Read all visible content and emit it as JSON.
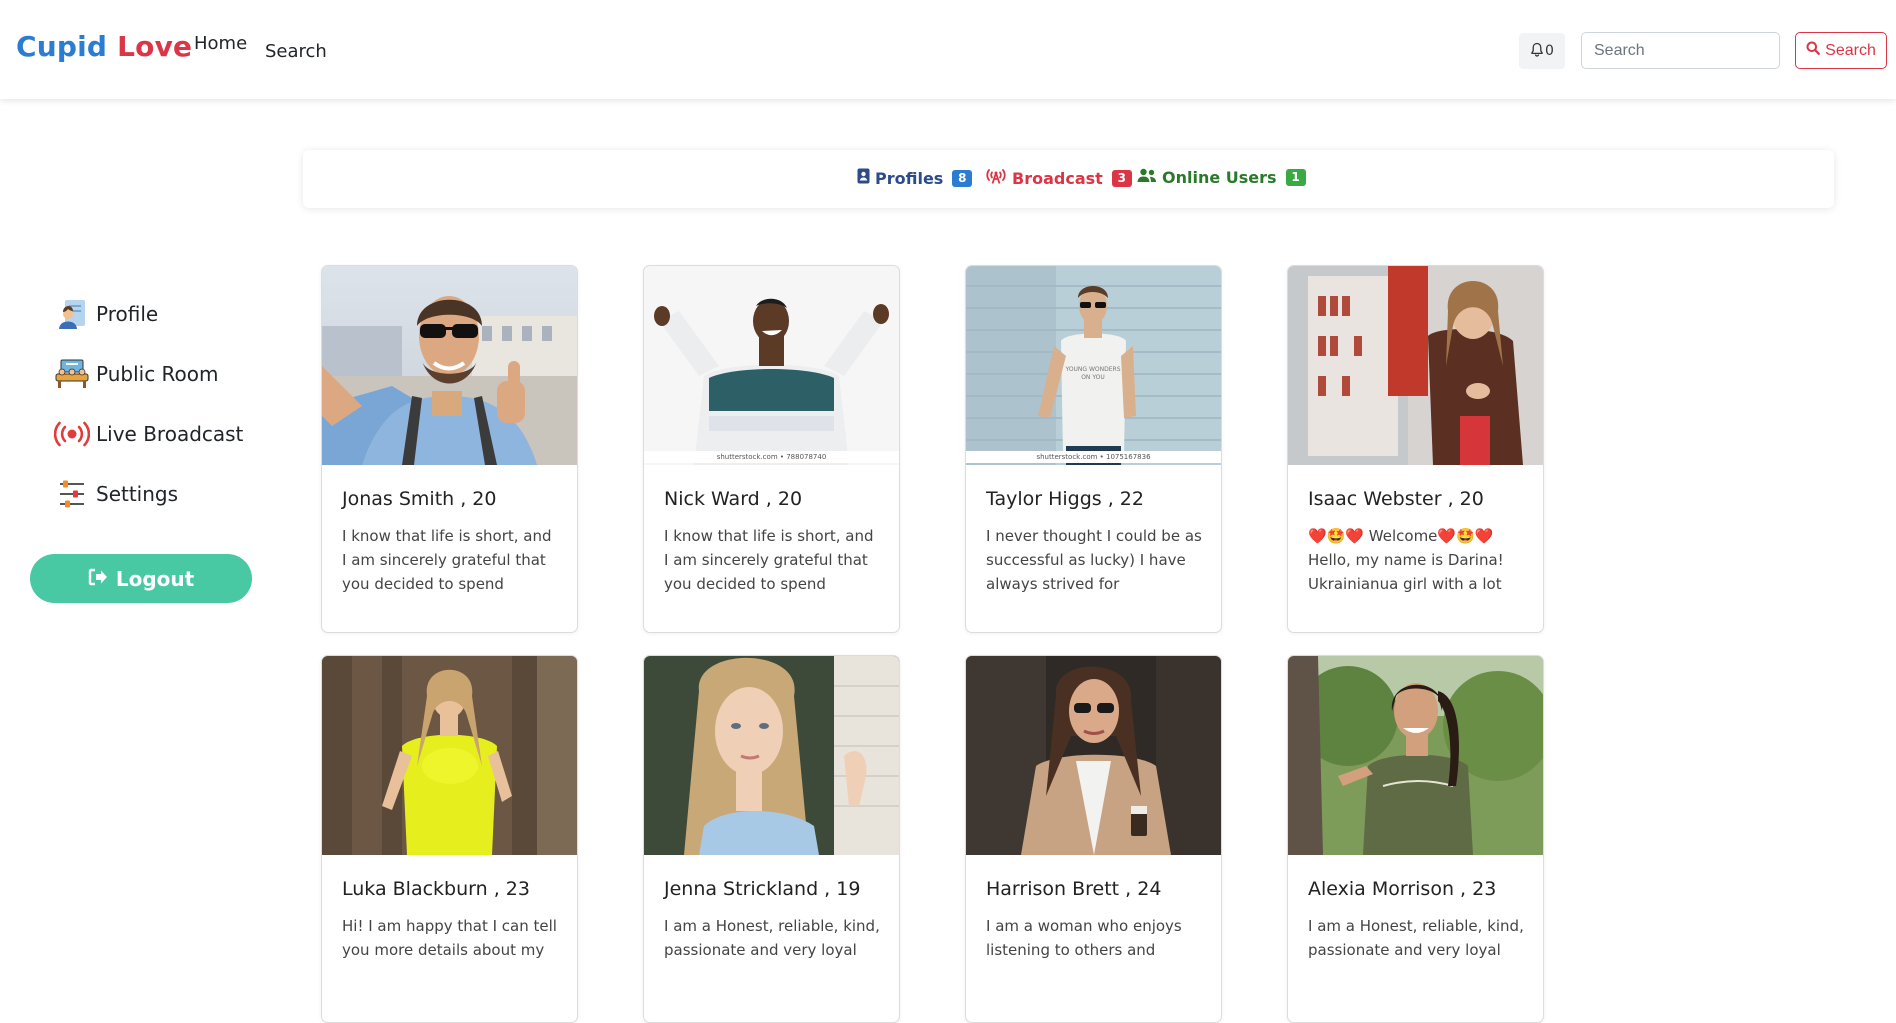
{
  "brand": {
    "part1": "Cupid",
    "part2": "Love"
  },
  "nav": {
    "home": "Home",
    "search": "Search"
  },
  "notifications": {
    "count": "0"
  },
  "search": {
    "placeholder": "Search",
    "button_label": "Search"
  },
  "tabs": [
    {
      "label": "Profiles",
      "count": "8"
    },
    {
      "label": "Broadcast",
      "count": "3"
    },
    {
      "label": "Online Users",
      "count": "1"
    }
  ],
  "sidebar": {
    "items": [
      {
        "label": "Profile"
      },
      {
        "label": "Public Room"
      },
      {
        "label": "Live Broadcast"
      },
      {
        "label": "Settings"
      }
    ],
    "logout_label": "Logout"
  },
  "profiles": [
    {
      "name": "Jonas Smith , 20",
      "bio": "I know that life is short, and I am sincerely grateful that you decided to spend several..."
    },
    {
      "name": "Nick Ward , 20",
      "bio": "I know that life is short, and I am sincerely grateful that you decided to spend several...",
      "watermark": "shutterstock.com • 788078740"
    },
    {
      "name": "Taylor Higgs , 22",
      "bio": "I never thought I could be as successful as lucky) I have always strived for simplicity...",
      "watermark": "shutterstock.com • 1075167836"
    },
    {
      "name": "Isaac Webster , 20",
      "bio": "❤️🤩❤️ Welcome❤️🤩❤️ Hello, my name is Darina! Ukrainianua girl with a lot of..."
    },
    {
      "name": "Luka Blackburn , 23",
      "bio": "Hi! I am happy that I can tell you more details about my"
    },
    {
      "name": "Jenna Strickland , 19",
      "bio": "I am a Honest, reliable, kind, passionate and very loyal"
    },
    {
      "name": "Harrison Brett , 24",
      "bio": "I am a woman who enjoys listening to others and"
    },
    {
      "name": "Alexia Morrison , 23",
      "bio": "I am a Honest, reliable, kind, passionate and very loyal"
    }
  ]
}
